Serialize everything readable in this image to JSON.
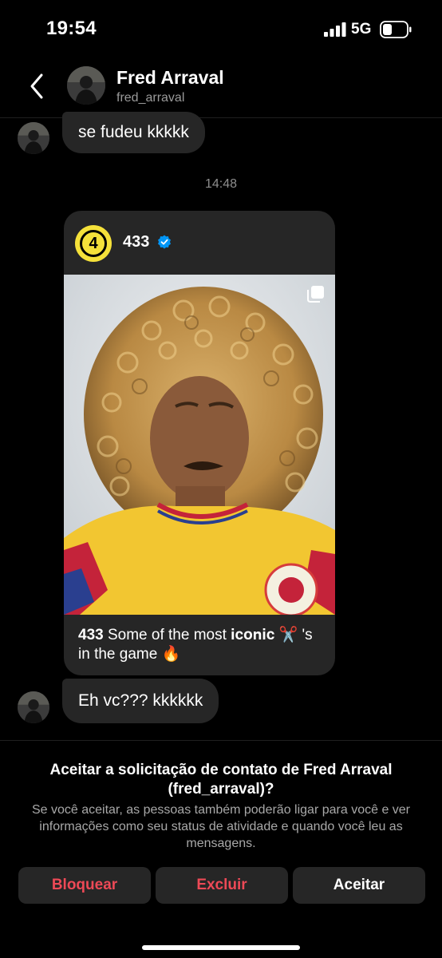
{
  "status_bar": {
    "time": "19:54",
    "network": "5G",
    "signal_icon": "cellular-signal-icon",
    "battery_icon": "battery-icon"
  },
  "header": {
    "back_icon": "chevron-left-icon",
    "name": "Fred Arraval",
    "username": "fred_arraval"
  },
  "messages": [
    {
      "text": "se fudeu kkkkk"
    },
    {
      "text": "Eh vc??? kkkkkk"
    }
  ],
  "timestamp": "14:48",
  "shared_post": {
    "account": "433",
    "logo_text": "4",
    "verified_icon": "verified-badge-icon",
    "multi_icon": "carousel-icon",
    "caption_account": "433",
    "caption_text": " Some of the most 𝐢𝐜𝐨𝐧𝐢𝐜 ✂️ 's in the game 🔥"
  },
  "request": {
    "title": "Aceitar a solicitação de contato de Fred Arraval (fred_arraval)?",
    "body": "Se você aceitar, as pessoas também poderão ligar para você e ver informações como seu status de atividade e quando você leu as mensagens.",
    "block_label": "Bloquear",
    "delete_label": "Excluir",
    "accept_label": "Aceitar"
  },
  "colors": {
    "background": "#000000",
    "bubble": "#262626",
    "danger": "#ed4956",
    "verified": "#0095f6",
    "logo": "#f5e13a"
  }
}
